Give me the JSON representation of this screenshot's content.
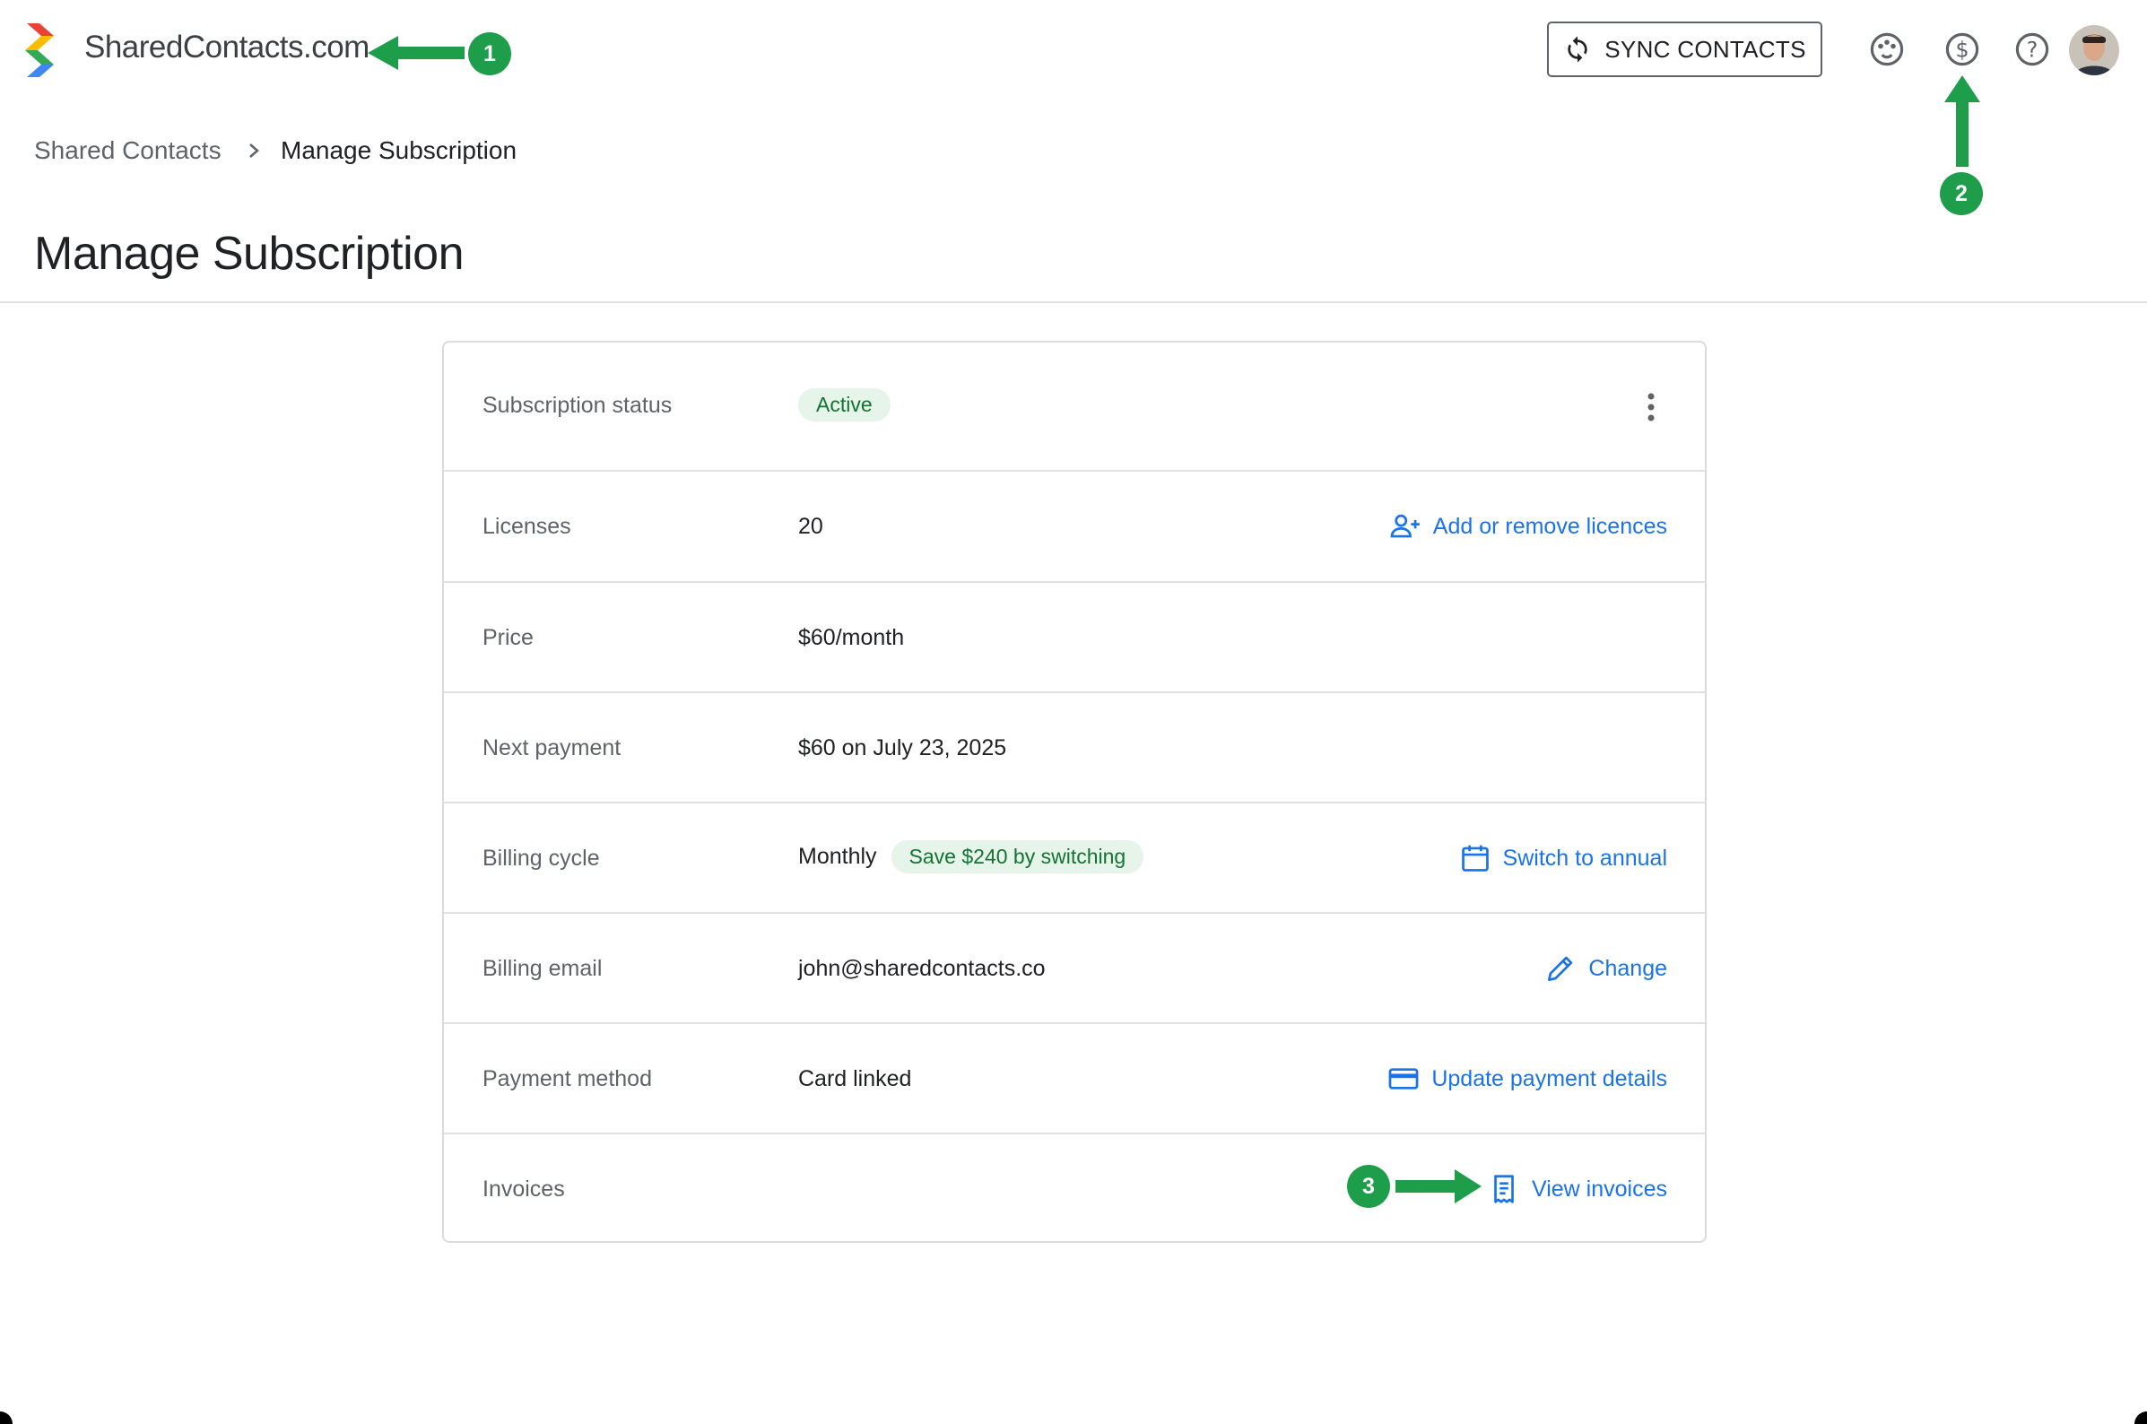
{
  "header": {
    "brand": "SharedContacts.com",
    "sync_label": "SYNC CONTACTS",
    "icons": [
      "palette-icon",
      "dollar-circle-icon",
      "help-icon",
      "avatar"
    ]
  },
  "breadcrumb": {
    "root": "Shared Contacts",
    "current": "Manage Subscription"
  },
  "page": {
    "title": "Manage Subscription"
  },
  "subscription": {
    "status": {
      "label": "Subscription status",
      "value": "Active"
    },
    "licenses": {
      "label": "Licenses",
      "value": "20",
      "action": "Add or remove licences"
    },
    "price": {
      "label": "Price",
      "value": "$60/month"
    },
    "next_payment": {
      "label": "Next payment",
      "value": "$60 on July 23, 2025"
    },
    "billing_cycle": {
      "label": "Billing cycle",
      "value": "Monthly",
      "badge": "Save $240 by switching",
      "action": "Switch to annual"
    },
    "billing_email": {
      "label": "Billing email",
      "value": "john@sharedcontacts.co",
      "action": "Change"
    },
    "payment_method": {
      "label": "Payment method",
      "value": "Card linked",
      "action": "Update payment details"
    },
    "invoices": {
      "label": "Invoices",
      "action": "View invoices"
    }
  },
  "annotations": {
    "one": "1",
    "two": "2",
    "three": "3"
  },
  "colors": {
    "accent": "#1a73e8",
    "annotation": "#1e9e4a",
    "chip_bg": "#e6f4ea",
    "chip_text": "#137333"
  }
}
